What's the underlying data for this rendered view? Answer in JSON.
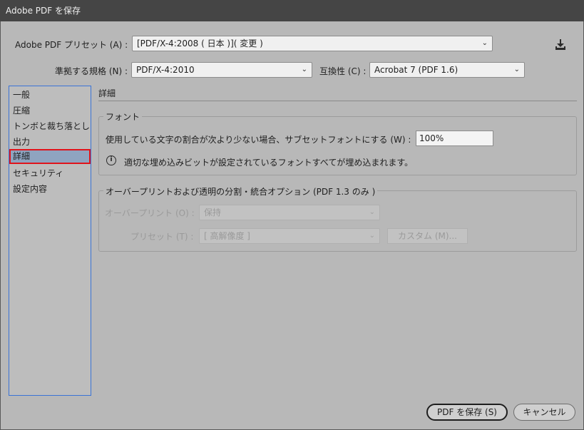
{
  "window": {
    "title": "Adobe PDF を保存"
  },
  "preset": {
    "label": "Adobe PDF プリセット (A) :",
    "value": "[PDF/X-4:2008 ( 日本 )]( 変更 )",
    "save_icon": "save-preset-icon"
  },
  "standard": {
    "label": "準拠する規格 (N) :",
    "value": "PDF/X-4:2010"
  },
  "compat": {
    "label": "互換性 (C) :",
    "value": "Acrobat 7 (PDF 1.6)"
  },
  "sidebar": {
    "items": [
      {
        "label": "一般"
      },
      {
        "label": "圧縮"
      },
      {
        "label": "トンボと裁ち落とし"
      },
      {
        "label": "出力"
      },
      {
        "label": "詳細",
        "selected": true
      },
      {
        "label": "セキュリティ"
      },
      {
        "label": "設定内容"
      }
    ]
  },
  "main": {
    "title": "詳細",
    "fonts": {
      "title": "フォント",
      "subset_label": "使用している文字の割合が次より少ない場合、サブセットフォントにする (W) :",
      "subset_value": "100%",
      "info_icon": "info-icon",
      "info_text": "適切な埋め込みビットが設定されているフォントすべてが埋め込まれます。"
    },
    "overprint": {
      "title": "オーバープリントおよび透明の分割・統合オプション (PDF 1.3 のみ )",
      "op_label": "オーバープリント (O) :",
      "op_value": "保持",
      "preset_label": "プリセット (T) :",
      "preset_value": "[ 高解像度 ]",
      "custom_button": "カスタム (M)..."
    }
  },
  "footer": {
    "save_button": "PDF を保存 (S)",
    "cancel_button": "キャンセル"
  },
  "colors": {
    "selection_outline": "#e0141b",
    "sidebar_border": "#3a73d6"
  }
}
